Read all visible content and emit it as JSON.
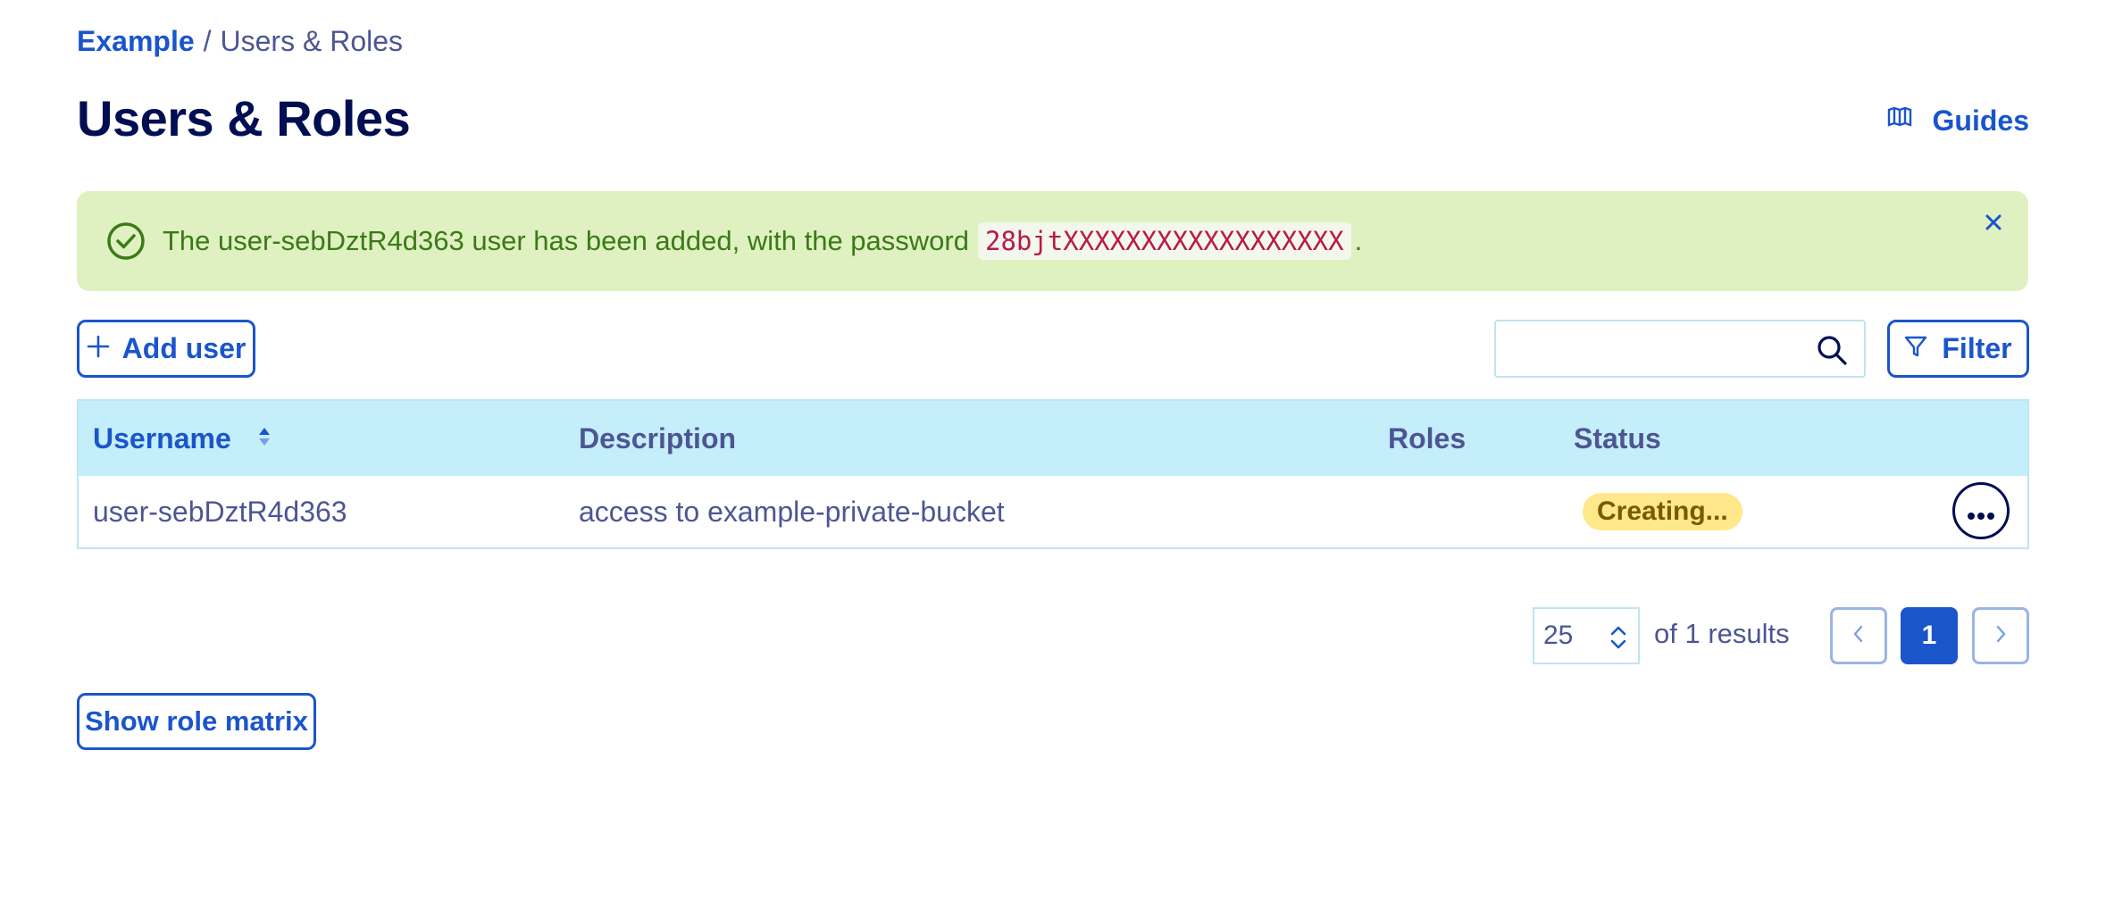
{
  "breadcrumb": {
    "root": "Example",
    "separator": "/",
    "current": "Users & Roles"
  },
  "page": {
    "title": "Users & Roles"
  },
  "guides": {
    "label": "Guides",
    "icon": "book-icon"
  },
  "alert": {
    "message_before": "The user-sebDztR4d363 user has been added, with the password",
    "password": "28bjtXXXXXXXXXXXXXXXXXX",
    "message_after": ".",
    "icon": "check-circle-icon",
    "color": "#dff1c0"
  },
  "toolbar": {
    "add_user_label": "Add user",
    "search_placeholder": "",
    "filter_label": "Filter"
  },
  "table": {
    "columns": {
      "username": "Username",
      "description": "Description",
      "roles": "Roles",
      "status": "Status"
    },
    "rows": [
      {
        "username": "user-sebDztR4d363",
        "description": "access to example-private-bucket",
        "roles": "",
        "status": "Creating..."
      }
    ]
  },
  "pagination": {
    "per_page": "25",
    "results_text": "of 1 results",
    "current_page": "1"
  },
  "role_matrix_label": "Show role matrix",
  "colors": {
    "primary": "#1a55cc",
    "title": "#000e52",
    "header_bg": "#c5eefb",
    "badge_bg": "#ffe88a"
  }
}
